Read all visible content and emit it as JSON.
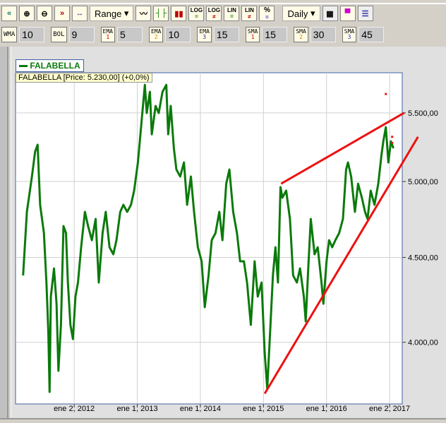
{
  "toolbar": {
    "range_label": "Range",
    "interval_label": "Daily",
    "buttons": [
      "scroll-left",
      "zoom-in",
      "zoom-out",
      "scroll-right",
      "fit",
      "line-chart",
      "bar-chart",
      "candle-chart",
      "log-equal",
      "log-not-equal",
      "lin-equal",
      "lin-not-equal",
      "percent",
      "chart-style",
      "colors",
      "properties"
    ],
    "log": "LOG",
    "lin": "LIN",
    "pct": "%"
  },
  "indicators": [
    {
      "name": "WMA",
      "sub": "",
      "value": "10"
    },
    {
      "name": "BOL",
      "sub": "",
      "value": "9"
    },
    {
      "name": "EMA",
      "sub": "1",
      "value": "5"
    },
    {
      "name": "EMA",
      "sub": "2",
      "value": "10"
    },
    {
      "name": "EMA",
      "sub": "3",
      "value": "15"
    },
    {
      "name": "SMA",
      "sub": "1",
      "value": "15"
    },
    {
      "name": "SMA",
      "sub": "2",
      "value": "30"
    },
    {
      "name": "SMA",
      "sub": "3",
      "value": "45"
    }
  ],
  "legend": {
    "label": "FALABELLA",
    "tooltip": "FALABELLA [Price: 5.230,00] (+0,0%)"
  },
  "colors": {
    "series": "#0a7a0a",
    "trend": "#ee1111",
    "grid": "#d0d0d0",
    "border": "#4060a0"
  },
  "chart_data": {
    "type": "line",
    "scale": "log",
    "xlim": [
      2011.07,
      2017.2
    ],
    "ylim": [
      3672,
      5815
    ],
    "yticks": [
      {
        "v": 5500,
        "label": "5.500,00"
      },
      {
        "v": 5000,
        "label": "5.000,00"
      },
      {
        "v": 4500,
        "label": "4.500,00"
      },
      {
        "v": 4000,
        "label": "4.000,00"
      }
    ],
    "xticks": [
      {
        "v": 2012.0,
        "label": "ene 2, 2012"
      },
      {
        "v": 2013.0,
        "label": "ene 1, 2013"
      },
      {
        "v": 2014.0,
        "label": "ene 1, 2014"
      },
      {
        "v": 2015.0,
        "label": "ene 1, 2015"
      },
      {
        "v": 2016.0,
        "label": "ene 1, 2016"
      },
      {
        "v": 2017.0,
        "label": "ene 2, 2017"
      }
    ],
    "series": [
      {
        "name": "FALABELLA",
        "points": [
          [
            2011.19,
            4389
          ],
          [
            2011.25,
            4794
          ],
          [
            2011.33,
            5035
          ],
          [
            2011.38,
            5211
          ],
          [
            2011.42,
            5262
          ],
          [
            2011.46,
            4841
          ],
          [
            2011.52,
            4655
          ],
          [
            2011.56,
            4346
          ],
          [
            2011.59,
            4058
          ],
          [
            2011.61,
            3734
          ],
          [
            2011.63,
            4262
          ],
          [
            2011.68,
            4432
          ],
          [
            2011.72,
            4220
          ],
          [
            2011.75,
            3845
          ],
          [
            2011.79,
            4098
          ],
          [
            2011.83,
            4700
          ],
          [
            2011.87,
            4655
          ],
          [
            2011.9,
            4346
          ],
          [
            2011.94,
            4098
          ],
          [
            2011.98,
            4018
          ],
          [
            2012.02,
            4262
          ],
          [
            2012.06,
            4346
          ],
          [
            2012.11,
            4564
          ],
          [
            2012.17,
            4794
          ],
          [
            2012.22,
            4700
          ],
          [
            2012.28,
            4609
          ],
          [
            2012.34,
            4747
          ],
          [
            2012.39,
            4346
          ],
          [
            2012.45,
            4655
          ],
          [
            2012.5,
            4794
          ],
          [
            2012.56,
            4564
          ],
          [
            2012.62,
            4520
          ],
          [
            2012.67,
            4609
          ],
          [
            2012.73,
            4794
          ],
          [
            2012.78,
            4841
          ],
          [
            2012.84,
            4794
          ],
          [
            2012.9,
            4841
          ],
          [
            2012.95,
            4937
          ],
          [
            2013.01,
            5134
          ],
          [
            2013.06,
            5392
          ],
          [
            2013.12,
            5718
          ],
          [
            2013.15,
            5499
          ],
          [
            2013.2,
            5663
          ],
          [
            2013.23,
            5339
          ],
          [
            2013.29,
            5553
          ],
          [
            2013.34,
            5499
          ],
          [
            2013.4,
            5663
          ],
          [
            2013.46,
            5718
          ],
          [
            2013.49,
            5339
          ],
          [
            2013.53,
            5553
          ],
          [
            2013.58,
            5236
          ],
          [
            2013.62,
            5084
          ],
          [
            2013.68,
            5035
          ],
          [
            2013.74,
            5134
          ],
          [
            2013.79,
            4841
          ],
          [
            2013.85,
            5035
          ],
          [
            2013.9,
            4794
          ],
          [
            2013.96,
            4564
          ],
          [
            2014.02,
            4476
          ],
          [
            2014.07,
            4200
          ],
          [
            2014.13,
            4389
          ],
          [
            2014.18,
            4609
          ],
          [
            2014.24,
            4655
          ],
          [
            2014.3,
            4794
          ],
          [
            2014.35,
            4609
          ],
          [
            2014.41,
            4985
          ],
          [
            2014.46,
            5084
          ],
          [
            2014.52,
            4794
          ],
          [
            2014.58,
            4655
          ],
          [
            2014.63,
            4476
          ],
          [
            2014.69,
            4476
          ],
          [
            2014.74,
            4346
          ],
          [
            2014.8,
            4098
          ],
          [
            2014.86,
            4476
          ],
          [
            2014.91,
            4262
          ],
          [
            2014.97,
            4346
          ],
          [
            2015.02,
            3940
          ],
          [
            2015.06,
            3752
          ],
          [
            2015.1,
            4018
          ],
          [
            2015.15,
            4389
          ],
          [
            2015.19,
            4564
          ],
          [
            2015.23,
            4346
          ],
          [
            2015.27,
            4961
          ],
          [
            2015.3,
            4889
          ],
          [
            2015.36,
            4937
          ],
          [
            2015.42,
            4747
          ],
          [
            2015.47,
            4389
          ],
          [
            2015.53,
            4346
          ],
          [
            2015.58,
            4432
          ],
          [
            2015.64,
            4262
          ],
          [
            2015.67,
            4118
          ],
          [
            2015.71,
            4432
          ],
          [
            2015.75,
            4747
          ],
          [
            2015.81,
            4520
          ],
          [
            2015.86,
            4564
          ],
          [
            2015.92,
            4346
          ],
          [
            2015.95,
            4220
          ],
          [
            2016.0,
            4476
          ],
          [
            2016.04,
            4609
          ],
          [
            2016.09,
            4564
          ],
          [
            2016.14,
            4609
          ],
          [
            2016.2,
            4655
          ],
          [
            2016.26,
            4747
          ],
          [
            2016.31,
            5084
          ],
          [
            2016.34,
            5134
          ],
          [
            2016.39,
            5035
          ],
          [
            2016.45,
            4794
          ],
          [
            2016.5,
            4985
          ],
          [
            2016.56,
            4889
          ],
          [
            2016.61,
            4794
          ],
          [
            2016.65,
            4747
          ],
          [
            2016.7,
            4937
          ],
          [
            2016.76,
            4841
          ],
          [
            2016.82,
            4985
          ],
          [
            2016.87,
            5185
          ],
          [
            2016.9,
            5287
          ],
          [
            2016.94,
            5392
          ],
          [
            2016.98,
            5134
          ],
          [
            2017.02,
            5287
          ],
          [
            2017.06,
            5236
          ]
        ]
      }
    ],
    "trendlines": [
      [
        [
          2015.28,
          4985
        ],
        [
          2017.23,
          5500
        ]
      ],
      [
        [
          2015.02,
          3725
        ],
        [
          2017.45,
          5320
        ]
      ]
    ],
    "markers": [
      [
        2016.94,
        5646
      ],
      [
        2017.04,
        5320
      ],
      [
        2017.04,
        5275
      ]
    ]
  }
}
